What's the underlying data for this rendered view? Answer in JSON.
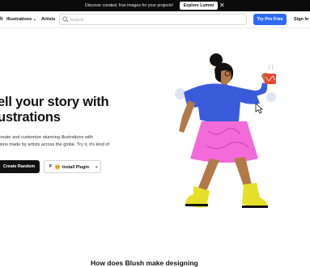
{
  "announcement": {
    "message": "Discover curated, free images for your projects!",
    "cta": "Explore Lummi",
    "close": "✕"
  },
  "header": {
    "logo_fragment": "h",
    "nav": [
      {
        "label": "Illustrations",
        "chevron": "⌄"
      },
      {
        "label": "Artists"
      }
    ],
    "search_placeholder": "Search",
    "try_pro": "Try Pro Free",
    "sign_in": "Sign In"
  },
  "hero": {
    "title_line1": "ell your story with",
    "title_line2": "ustrations",
    "desc_line1": "create and customize stunning illustrations with",
    "desc_line2": "tions made by artists across the globe. Try it, it's kind of",
    "btn_random": "Create Random",
    "btn_plugin_prefix": "F",
    "btn_plugin": "Install Plugin",
    "btn_plugin_chevron": "⌄"
  },
  "section": {
    "heading": "How does Blush make designing"
  },
  "colors": {
    "accent": "#2f6bf2",
    "topbar": "#0b0b0b",
    "shirt": "#3a5bd9",
    "skirt": "#f26bd9",
    "skin": "#b27a4a",
    "boots": "#e6e02a"
  }
}
